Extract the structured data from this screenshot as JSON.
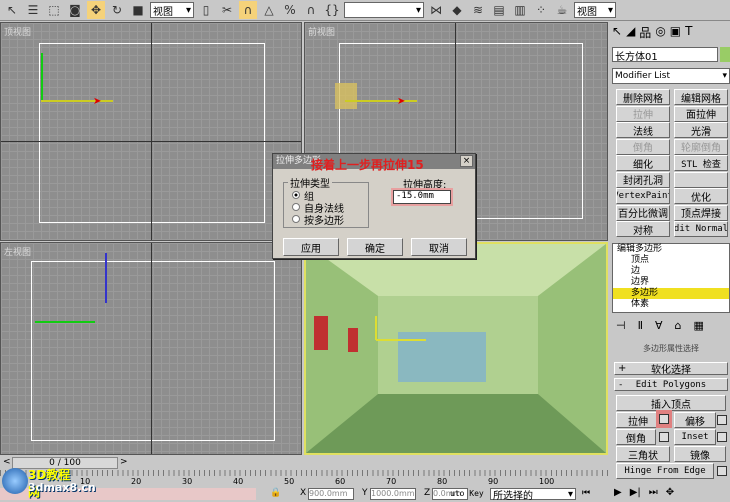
{
  "toolbar": {
    "view_select": "视图",
    "view_select2": "视图",
    "named_sel": "",
    "colors": {
      "active": "#f5d27a"
    }
  },
  "viewports": {
    "top": "顶视图",
    "front": "前视图",
    "left": "左视图",
    "perspective": ""
  },
  "dialog": {
    "title": "拉伸多边形",
    "annotation": "接着上一步再拉伸15",
    "group_label": "拉伸类型",
    "options": [
      "组",
      "自身法线",
      "按多边形"
    ],
    "selected": 0,
    "height_label": "拉伸高度:",
    "height_value": "-15.0mm",
    "apply": "应用",
    "ok": "确定",
    "cancel": "取消"
  },
  "panel": {
    "object_name": "长方体01",
    "modifier_list": "Modifier List",
    "buttons": [
      "删除网格",
      "编辑网格",
      "拉伸",
      "面拉伸",
      "法线",
      "光滑",
      "倒角",
      "轮廓倒角",
      "细化",
      "STL 检查",
      "封闭孔洞",
      "",
      "VertexPaint",
      "优化",
      "百分比微调",
      "顶点焊接",
      "对称",
      "dit Normal"
    ],
    "stack": [
      "编辑多边形",
      "顶点",
      "边",
      "边界",
      "多边形",
      "体素"
    ],
    "stack_selected": 4,
    "rollout_title": "多边形属性选择",
    "soft_sel": "软化选择",
    "edit_polys": "Edit Polygons",
    "insert_vertex": "插入顶点",
    "extrude": "拉伸",
    "outline": "偏移",
    "bevel": "倒角",
    "inset": "Inset",
    "triangulate": "三角状",
    "mirror": "镜像",
    "hinge": "Hinge From Edge"
  },
  "timeline": {
    "frame": "0 / 100",
    "ticks": [
      "10",
      "20",
      "30",
      "40",
      "50",
      "60",
      "70",
      "80",
      "90",
      "100"
    ]
  },
  "status": {
    "x": "900.0mm",
    "y": "1000.0mm",
    "z": "0.0mm",
    "autokey": "uto Key",
    "key_select": "所选择的"
  },
  "watermark": {
    "line1": "3D教程网",
    "line2": "3dmax8.cn"
  }
}
